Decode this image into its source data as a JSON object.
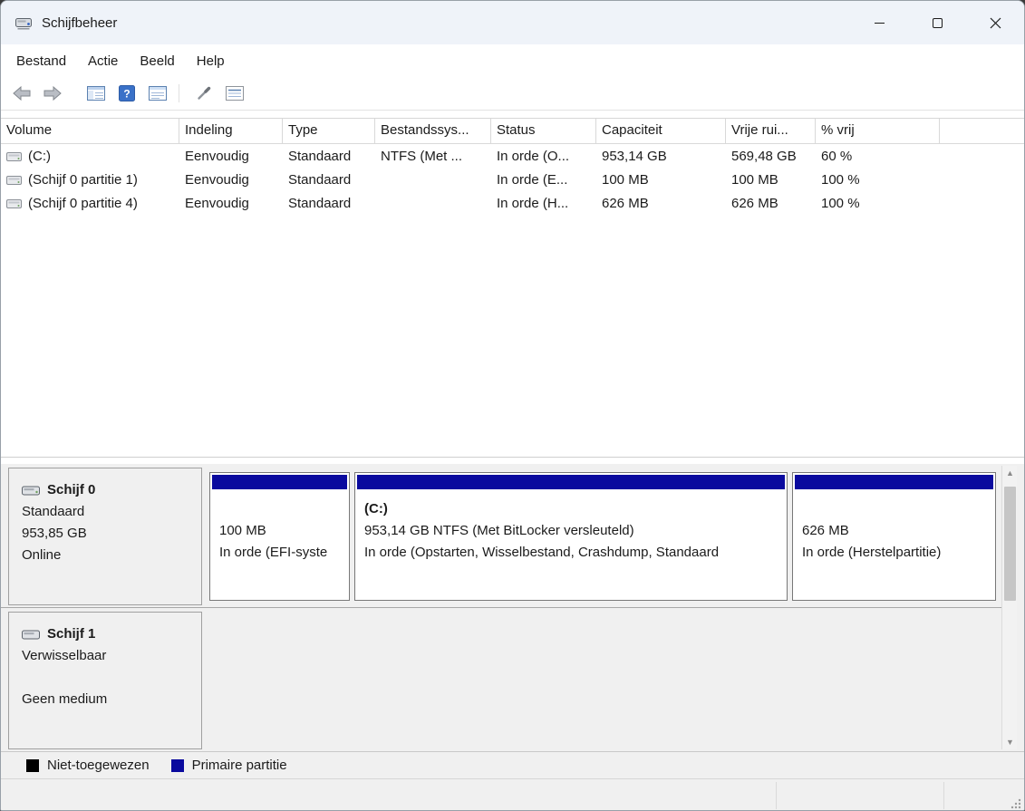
{
  "window": {
    "title": "Schijfbeheer"
  },
  "menubar": {
    "items": [
      "Bestand",
      "Actie",
      "Beeld",
      "Help"
    ]
  },
  "toolbar": {
    "icons": [
      "back",
      "forward",
      "console-tree",
      "help",
      "export-list",
      "tools",
      "list-view"
    ]
  },
  "volume_table": {
    "columns": {
      "volume": "Volume",
      "indeling": "Indeling",
      "type": "Type",
      "fs": "Bestandssys...",
      "status": "Status",
      "capacity": "Capaciteit",
      "free": "Vrije rui...",
      "pct_free": "% vrij"
    },
    "rows": [
      {
        "volume": "(C:)",
        "indeling": "Eenvoudig",
        "type": "Standaard",
        "fs": "NTFS (Met ...",
        "status": "In orde (O...",
        "capacity": "953,14 GB",
        "free": "569,48 GB",
        "pct_free": "60 %"
      },
      {
        "volume": "(Schijf 0 partitie 1)",
        "indeling": "Eenvoudig",
        "type": "Standaard",
        "fs": "",
        "status": "In orde (E...",
        "capacity": "100 MB",
        "free": "100 MB",
        "pct_free": "100 %"
      },
      {
        "volume": "(Schijf 0 partitie 4)",
        "indeling": "Eenvoudig",
        "type": "Standaard",
        "fs": "",
        "status": "In orde (H...",
        "capacity": "626 MB",
        "free": "626 MB",
        "pct_free": "100 %"
      }
    ]
  },
  "graphical_view": {
    "disks": [
      {
        "name": "Schijf 0",
        "type": "Standaard",
        "size": "953,85 GB",
        "status": "Online",
        "partitions": [
          {
            "title": "",
            "info": "100 MB",
            "status": "In orde (EFI-syste"
          },
          {
            "title": "(C:)",
            "info": "953,14 GB NTFS (Met BitLocker versleuteld)",
            "status": "In orde (Opstarten, Wisselbestand, Crashdump, Standaard"
          },
          {
            "title": "",
            "info": "626 MB",
            "status": "In orde (Herstelpartitie)"
          }
        ]
      },
      {
        "name": "Schijf 1",
        "type": "Verwisselbaar",
        "size": "",
        "status": "Geen medium",
        "partitions": []
      }
    ]
  },
  "legend": {
    "items": [
      {
        "label": "Niet-toegewezen",
        "color": "#000000"
      },
      {
        "label": "Primaire partitie",
        "color": "#0a0a9e"
      }
    ]
  },
  "colors": {
    "primary_partition": "#0a0a9e",
    "unallocated": "#000000"
  }
}
